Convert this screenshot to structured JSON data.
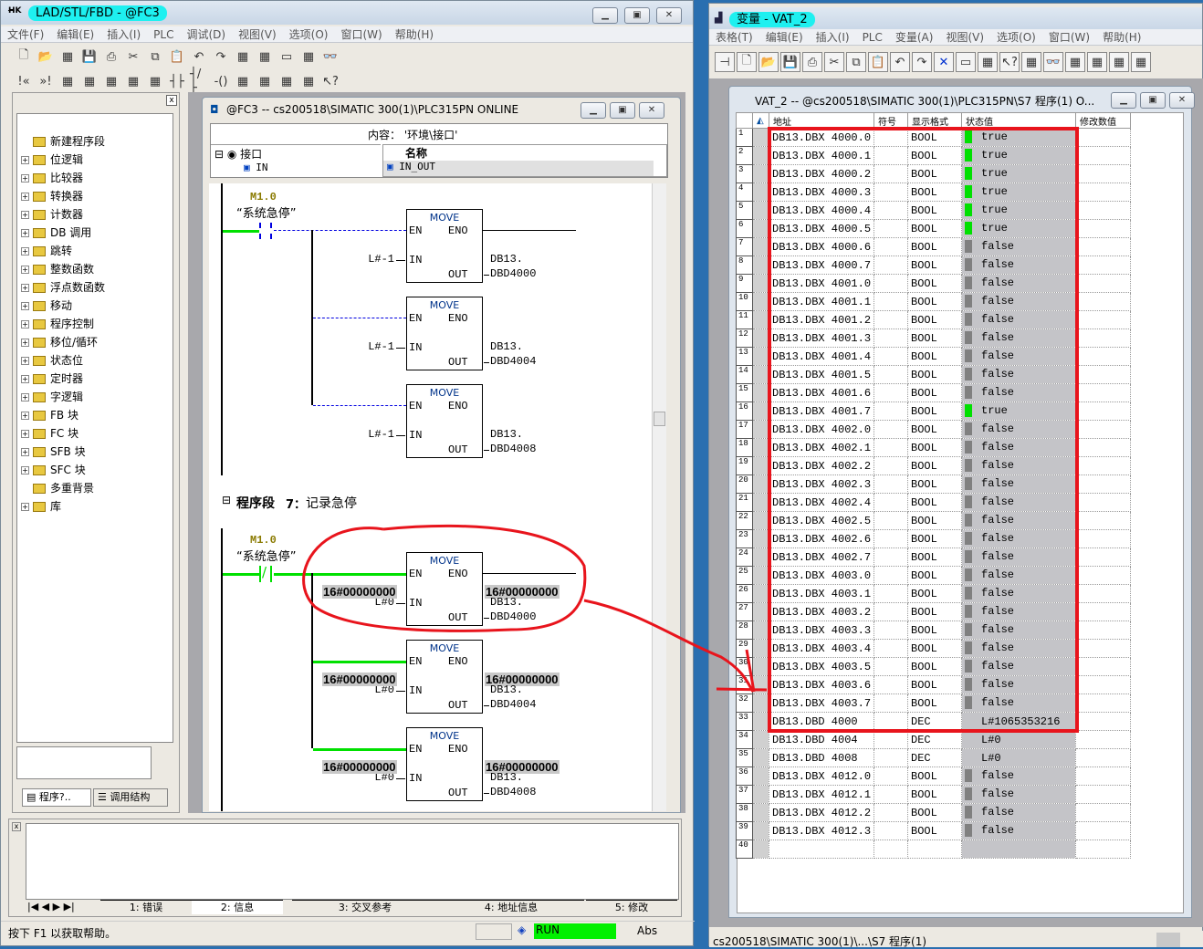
{
  "left_window": {
    "title": "LAD/STL/FBD  - @FC3",
    "menu": [
      "文件(F)",
      "编辑(E)",
      "插入(I)",
      "PLC",
      "调试(D)",
      "视图(V)",
      "选项(O)",
      "窗口(W)",
      "帮助(H)"
    ],
    "toolbar1_icons": [
      "new-icon",
      "open-icon",
      "network-icon",
      "save-icon",
      "print-icon",
      "cut-icon",
      "copy-icon",
      "paste-icon",
      "undo-icon",
      "redo-icon",
      "download-icon",
      "upload-icon",
      "online-icon",
      "nodes-icon",
      "monitor-icon"
    ],
    "toolbar2_icons": [
      "prev-icon",
      "next-icon",
      "overview-icon",
      "detail-icon",
      "new-network-icon",
      "branch-icon",
      "insert-icon",
      "contact-no-icon",
      "contact-nc-icon",
      "coil-icon",
      "box-icon",
      "branch-open-icon",
      "branch-close-icon",
      "connect-icon",
      "help-pointer-icon"
    ],
    "catalog": {
      "items": [
        {
          "label": "新建程序段",
          "expand": false
        },
        {
          "label": "位逻辑",
          "expand": true
        },
        {
          "label": "比较器",
          "expand": true
        },
        {
          "label": "转换器",
          "expand": true
        },
        {
          "label": "计数器",
          "expand": true
        },
        {
          "label": "DB 调用",
          "expand": true
        },
        {
          "label": "跳转",
          "expand": true
        },
        {
          "label": "整数函数",
          "expand": true
        },
        {
          "label": "浮点数函数",
          "expand": true
        },
        {
          "label": "移动",
          "expand": true
        },
        {
          "label": "程序控制",
          "expand": true
        },
        {
          "label": "移位/循环",
          "expand": true
        },
        {
          "label": "状态位",
          "expand": true
        },
        {
          "label": "定时器",
          "expand": true
        },
        {
          "label": "字逻辑",
          "expand": true
        },
        {
          "label": "FB 块",
          "expand": true
        },
        {
          "label": "FC 块",
          "expand": true
        },
        {
          "label": "SFB 块",
          "expand": true
        },
        {
          "label": "SFC 块",
          "expand": true
        },
        {
          "label": "多重背景",
          "expand": false
        },
        {
          "label": "库",
          "expand": true
        }
      ],
      "tabs": [
        "程序?..",
        "调用结构"
      ]
    },
    "editor": {
      "title": "@FC3 -- cs200518\\SIMATIC 300(1)\\PLC315PN  ONLINE",
      "content_label": "内容： '环境\\接口'",
      "tree_root": "接口",
      "tree_child": "IN",
      "name_header": "名称",
      "name_row": "IN_OUT",
      "network7_title": "程序段",
      "network7_num": "7：",
      "network7_comment": "记录急停",
      "networks": [
        {
          "contact_addr": "M1.0",
          "contact_sym": "“系统急停”",
          "contact": "no",
          "active": false,
          "boxes": [
            {
              "title": "MOVE",
              "en": "EN",
              "eno": "ENO",
              "in_label": "IN",
              "out_label": "OUT",
              "in_val": "L#-1",
              "in_status": "",
              "out_db": "DB13.",
              "out_addr": "DBD4000",
              "out_status": ""
            },
            {
              "title": "MOVE",
              "en": "EN",
              "eno": "ENO",
              "in_label": "IN",
              "out_label": "OUT",
              "in_val": "L#-1",
              "in_status": "",
              "out_db": "DB13.",
              "out_addr": "DBD4004",
              "out_status": ""
            },
            {
              "title": "MOVE",
              "en": "EN",
              "eno": "ENO",
              "in_label": "IN",
              "out_label": "OUT",
              "in_val": "L#-1",
              "in_status": "",
              "out_db": "DB13.",
              "out_addr": "DBD4008",
              "out_status": ""
            }
          ]
        },
        {
          "contact_addr": "M1.0",
          "contact_sym": "“系统急停”",
          "contact": "nc",
          "active": true,
          "boxes": [
            {
              "title": "MOVE",
              "en": "EN",
              "eno": "ENO",
              "in_label": "IN",
              "out_label": "OUT",
              "in_val": "L#0",
              "in_status": "16#00000000",
              "out_db": "DB13.",
              "out_addr": "DBD4000",
              "out_status": "16#00000000"
            },
            {
              "title": "MOVE",
              "en": "EN",
              "eno": "ENO",
              "in_label": "IN",
              "out_label": "OUT",
              "in_val": "L#0",
              "in_status": "16#00000000",
              "out_db": "DB13.",
              "out_addr": "DBD4004",
              "out_status": "16#00000000"
            },
            {
              "title": "MOVE",
              "en": "EN",
              "eno": "ENO",
              "in_label": "IN",
              "out_label": "OUT",
              "in_val": "L#0",
              "in_status": "16#00000000",
              "out_db": "DB13.",
              "out_addr": "DBD4008",
              "out_status": "16#00000000"
            }
          ]
        }
      ]
    },
    "output_tabs": [
      "1: 错误",
      "2: 信息",
      "3: 交叉参考",
      "4: 地址信息",
      "5: 修改"
    ],
    "status": {
      "help": "按下 F1 以获取帮助。",
      "mode": "RUN",
      "abs": "Abs"
    }
  },
  "right_window": {
    "title": "变量 - VAT_2",
    "menu": [
      "表格(T)",
      "编辑(E)",
      "插入(I)",
      "PLC",
      "变量(A)",
      "视图(V)",
      "选项(O)",
      "窗口(W)",
      "帮助(H)"
    ],
    "toolbar_icons": [
      "pin-icon",
      "new-icon",
      "open-icon",
      "save-icon",
      "print-icon",
      "cut-icon",
      "copy-icon",
      "paste-icon",
      "undo-icon",
      "redo-icon",
      "delete-icon",
      "online-icon",
      "nodes-icon",
      "help-pointer-icon",
      "trigger-icon",
      "monitor-icon",
      "modify-icon",
      "monitor-all-icon",
      "modify-all-icon",
      "force-icon"
    ],
    "vat_title": "VAT_2 -- @cs200518\\SIMATIC 300(1)\\PLC315PN\\S7 程序(1)  O...",
    "columns": [
      "地址",
      "符号",
      "显示格式",
      "状态值",
      "修改数值"
    ],
    "rows": [
      [
        "DB13.DBX 4000.0",
        "BOOL",
        "true"
      ],
      [
        "DB13.DBX 4000.1",
        "BOOL",
        "true"
      ],
      [
        "DB13.DBX 4000.2",
        "BOOL",
        "true"
      ],
      [
        "DB13.DBX 4000.3",
        "BOOL",
        "true"
      ],
      [
        "DB13.DBX 4000.4",
        "BOOL",
        "true"
      ],
      [
        "DB13.DBX 4000.5",
        "BOOL",
        "true"
      ],
      [
        "DB13.DBX 4000.6",
        "BOOL",
        "false"
      ],
      [
        "DB13.DBX 4000.7",
        "BOOL",
        "false"
      ],
      [
        "DB13.DBX 4001.0",
        "BOOL",
        "false"
      ],
      [
        "DB13.DBX 4001.1",
        "BOOL",
        "false"
      ],
      [
        "DB13.DBX 4001.2",
        "BOOL",
        "false"
      ],
      [
        "DB13.DBX 4001.3",
        "BOOL",
        "false"
      ],
      [
        "DB13.DBX 4001.4",
        "BOOL",
        "false"
      ],
      [
        "DB13.DBX 4001.5",
        "BOOL",
        "false"
      ],
      [
        "DB13.DBX 4001.6",
        "BOOL",
        "false"
      ],
      [
        "DB13.DBX 4001.7",
        "BOOL",
        "true"
      ],
      [
        "DB13.DBX 4002.0",
        "BOOL",
        "false"
      ],
      [
        "DB13.DBX 4002.1",
        "BOOL",
        "false"
      ],
      [
        "DB13.DBX 4002.2",
        "BOOL",
        "false"
      ],
      [
        "DB13.DBX 4002.3",
        "BOOL",
        "false"
      ],
      [
        "DB13.DBX 4002.4",
        "BOOL",
        "false"
      ],
      [
        "DB13.DBX 4002.5",
        "BOOL",
        "false"
      ],
      [
        "DB13.DBX 4002.6",
        "BOOL",
        "false"
      ],
      [
        "DB13.DBX 4002.7",
        "BOOL",
        "false"
      ],
      [
        "DB13.DBX 4003.0",
        "BOOL",
        "false"
      ],
      [
        "DB13.DBX 4003.1",
        "BOOL",
        "false"
      ],
      [
        "DB13.DBX 4003.2",
        "BOOL",
        "false"
      ],
      [
        "DB13.DBX 4003.3",
        "BOOL",
        "false"
      ],
      [
        "DB13.DBX 4003.4",
        "BOOL",
        "false"
      ],
      [
        "DB13.DBX 4003.5",
        "BOOL",
        "false"
      ],
      [
        "DB13.DBX 4003.6",
        "BOOL",
        "false"
      ],
      [
        "DB13.DBX 4003.7",
        "BOOL",
        "false"
      ],
      [
        "DB13.DBD 4000",
        "DEC",
        "L#1065353216"
      ],
      [
        "DB13.DBD 4004",
        "DEC",
        "L#0"
      ],
      [
        "DB13.DBD 4008",
        "DEC",
        "L#0"
      ],
      [
        "DB13.DBX 4012.0",
        "BOOL",
        "false"
      ],
      [
        "DB13.DBX 4012.1",
        "BOOL",
        "false"
      ],
      [
        "DB13.DBX 4012.2",
        "BOOL",
        "false"
      ],
      [
        "DB13.DBX 4012.3",
        "BOOL",
        "false"
      ],
      [
        "",
        "",
        ""
      ]
    ],
    "status_path": "cs200518\\SIMATIC 300(1)\\...\\S7 程序(1)"
  },
  "colors": {
    "true_indicator": "#00e000",
    "false_indicator": "#808080",
    "power_flow": "#00e000",
    "annotation": "#e8141c",
    "title_highlight": "#1ef0f0",
    "run": "#00f000"
  }
}
